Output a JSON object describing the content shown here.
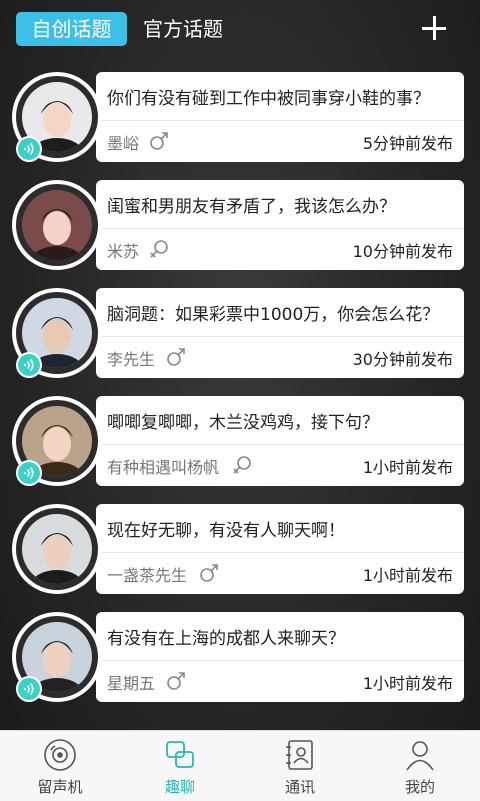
{
  "header": {
    "tab_active": "自创话题",
    "tab_official": "官方话题",
    "add_icon": "plus-icon"
  },
  "topics": [
    {
      "title": "你们有没有碰到工作中被同事穿小鞋的事？",
      "author": "墨峪",
      "gender": "male",
      "time": "5分钟前发布",
      "has_voice": true
    },
    {
      "title": "闺蜜和男朋友有矛盾了，我该怎么办？",
      "author": "米苏",
      "gender": "female",
      "time": "10分钟前发布",
      "has_voice": false
    },
    {
      "title": "脑洞题：如果彩票中1000万，你会怎么花？",
      "author": "李先生",
      "gender": "male",
      "time": "30分钟前发布",
      "has_voice": true
    },
    {
      "title": "唧唧复唧唧，木兰没鸡鸡，接下句？",
      "author": "有种相遇叫杨帆",
      "gender": "female",
      "time": "1小时前发布",
      "has_voice": true
    },
    {
      "title": "现在好无聊，有没有人聊天啊！",
      "author": "一盏茶先生",
      "gender": "male",
      "time": "1小时前发布",
      "has_voice": false
    },
    {
      "title": "有没有在上海的成都人来聊天？",
      "author": "星期五",
      "gender": "male",
      "time": "1小时前发布",
      "has_voice": true
    }
  ],
  "nav": [
    {
      "label": "留声机",
      "icon": "record-disc-icon",
      "active": false
    },
    {
      "label": "趣聊",
      "icon": "chat-squares-icon",
      "active": true
    },
    {
      "label": "通讯",
      "icon": "contacts-book-icon",
      "active": false
    },
    {
      "label": "我的",
      "icon": "person-icon",
      "active": false
    }
  ],
  "colors": {
    "accent": "#3cc0e8",
    "active_nav": "#2bb5b5",
    "voice_badge": "#3cd1c6"
  }
}
